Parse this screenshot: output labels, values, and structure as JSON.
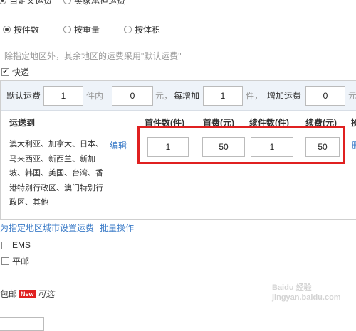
{
  "pricing_mode": {
    "top_option_1": "自定义运费",
    "top_option_2": "卖家承担运费"
  },
  "calc_mode": {
    "by_piece": "按件数",
    "by_weight": "按重量",
    "by_volume": "按体积"
  },
  "hint": "除指定地区外，其余地区的运费采用\"默认运费\"",
  "express": {
    "label": "快递",
    "checked": true
  },
  "default_fee": {
    "label": "默认运费",
    "first_qty": "1",
    "unit_within": "件内",
    "first_fee": "0",
    "yuan_comma": "元，",
    "each_add_label": "每增加",
    "add_qty": "1",
    "unit_piece": "件，",
    "add_fee_label": "增加运费",
    "add_fee": "0",
    "yuan": "元"
  },
  "table": {
    "headers": {
      "ship_to": "运送到",
      "first_count": "首件数(件)",
      "first_fee": "首费(元)",
      "add_count": "续件数(件)",
      "add_fee": "续费(元)",
      "cut_edge": "操"
    },
    "row": {
      "regions_lines": [
        "澳大利亚、加拿大、日本、",
        "马来西亚、新西兰、新加",
        "坡、韩国、美国、台湾、香",
        "港特别行政区、澳门特别行",
        "政区、其他"
      ],
      "edit": "编辑",
      "first_count": "1",
      "first_fee": "50",
      "add_count": "1",
      "add_fee": "50",
      "delete_cut": "删"
    }
  },
  "actions": {
    "set_city_fee": "为指定地区城市设置运费",
    "batch": "批量操作"
  },
  "other_methods": {
    "ems": "EMS",
    "pingyou": "平邮"
  },
  "free_shipping": {
    "label": "包邮",
    "new_badge": "New",
    "optional": "可选"
  },
  "highlight_color": "#e02020",
  "watermark": "Baidu 经验 jingyan.baidu.com"
}
